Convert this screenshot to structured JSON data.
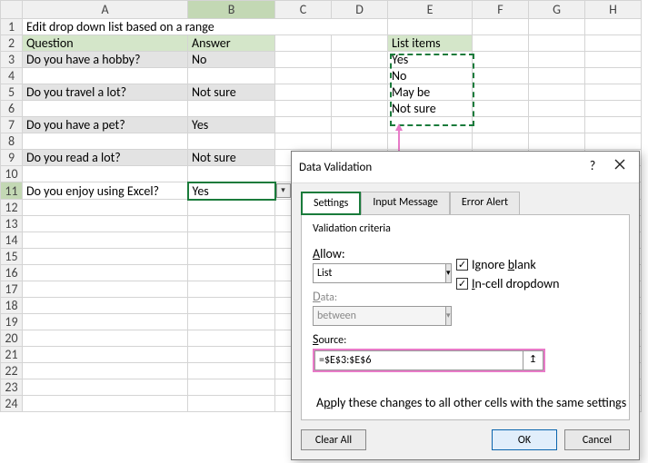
{
  "title": "Edit drop down list based on a range",
  "columns": [
    "A",
    "B",
    "C",
    "D",
    "E",
    "F",
    "G",
    "H"
  ],
  "rowCount": 24,
  "headers": {
    "question": "Question",
    "answer": "Answer",
    "listItems": "List items"
  },
  "rows": [
    {
      "q": "Do you have a hobby?",
      "a": "No",
      "shaded": true
    },
    {
      "q": "",
      "a": ""
    },
    {
      "q": "Do you travel a lot?",
      "a": "Not sure",
      "shaded": true
    },
    {
      "q": "",
      "a": ""
    },
    {
      "q": "Do you have a pet?",
      "a": "Yes",
      "shaded": true
    },
    {
      "q": "",
      "a": ""
    },
    {
      "q": "Do you read a lot?",
      "a": "Not sure",
      "shaded": true
    },
    {
      "q": "",
      "a": ""
    },
    {
      "q": "Do you enjoy using Excel?",
      "a": "Yes",
      "active": true
    }
  ],
  "listItems": [
    "Yes",
    "No",
    "May be",
    "Not sure"
  ],
  "dialog": {
    "title": "Data Validation",
    "tabs": [
      "Settings",
      "Input Message",
      "Error Alert"
    ],
    "activeTab": 0,
    "groupLabel": "Validation criteria",
    "allowLabel": "Allow:",
    "allowValue": "List",
    "dataLabel": "Data:",
    "dataValue": "between",
    "ignoreBlankLabel": "Ignore blank",
    "ignoreBlankChecked": true,
    "inCellLabel": "In-cell dropdown",
    "inCellChecked": true,
    "sourceLabel": "Source:",
    "sourceValue": "=$E$3:$E$6",
    "applyLabel": "Apply these changes to all other cells with the same settings",
    "applyChecked": false,
    "clearAll": "Clear All",
    "ok": "OK",
    "cancel": "Cancel"
  }
}
